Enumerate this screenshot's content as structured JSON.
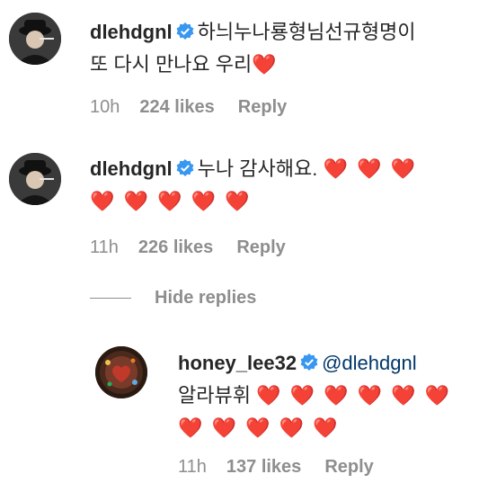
{
  "comments": [
    {
      "username": "dlehdgnl",
      "text_line1": "하늬누나룡형님선규형명이",
      "text_line2": "또 다시 만나요 우리",
      "hearts_line2": "❤️",
      "time": "10h",
      "likes": "224 likes",
      "reply": "Reply"
    },
    {
      "username": "dlehdgnl",
      "text_line1": "누나 감사해요.",
      "hearts_line1": "❤️ ❤️ ❤️",
      "hearts_line2": "❤️ ❤️ ❤️ ❤️ ❤️",
      "time": "11h",
      "likes": "226 likes",
      "reply": "Reply"
    }
  ],
  "hide_replies": "Hide replies",
  "reply": {
    "username": "honey_lee32",
    "mention": "@dlehdgnl",
    "text": "알라뷰휘",
    "hearts_line1": "❤️ ❤️ ❤️ ❤️ ❤️ ❤️",
    "hearts_line2": "❤️ ❤️ ❤️ ❤️ ❤️",
    "time": "11h",
    "likes": "137 likes",
    "reply_label": "Reply"
  },
  "colors": {
    "username": "#262626",
    "meta": "#8e8e8e",
    "verified_badge": "#3897f0",
    "heart": "#ed1c24"
  },
  "icons": [
    "verified-badge-icon",
    "heart-icon"
  ]
}
